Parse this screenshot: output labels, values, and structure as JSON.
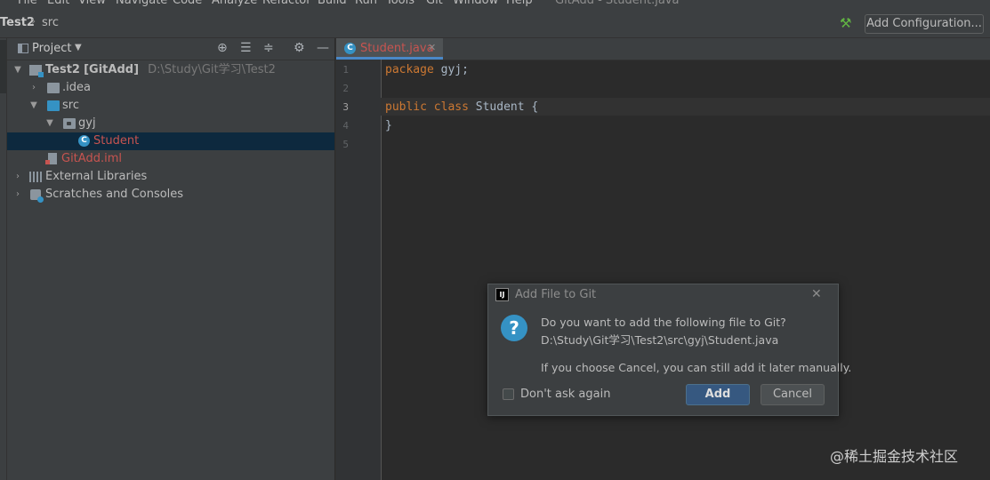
{
  "menu": [
    "File",
    "Edit",
    "View",
    "Navigate",
    "Code",
    "Analyze",
    "Refactor",
    "Build",
    "Run",
    "Tools",
    "Git",
    "Window",
    "Help",
    "GitAdd - Student.java"
  ],
  "breadcrumb": {
    "project": "Test2",
    "folder": "src"
  },
  "toolbar": {
    "run_config_label": "Add Configuration..."
  },
  "project_panel": {
    "title": "Project",
    "tree": [
      {
        "label": "Test2",
        "module": "[GitAdd]",
        "path": "D:\\Study\\Git学习\\Test2"
      },
      {
        "label": ".idea"
      },
      {
        "label": "src"
      },
      {
        "label": "gyj"
      },
      {
        "label": "Student"
      },
      {
        "label": "GitAdd.iml"
      },
      {
        "label": "External Libraries"
      },
      {
        "label": "Scratches and Consoles"
      }
    ]
  },
  "editor": {
    "tab": "Student.java",
    "line_numbers": [
      "1",
      "2",
      "3",
      "4",
      "5"
    ],
    "code": {
      "l1_kw": "package",
      "l1_rest": " gyj;",
      "l3_kw1": "public",
      "l3_kw2": "class",
      "l3_rest": " Student {",
      "l4": "}"
    }
  },
  "dialog": {
    "title": "Add File to Git",
    "question": "Do you want to add the following file to Git?",
    "path": "D:\\Study\\Git学习\\Test2\\src\\gyj\\Student.java",
    "note": "If you choose Cancel, you can still add it later manually.",
    "checkbox_label": "Don't ask again",
    "checkbox_checked": false,
    "add_button": "Add",
    "cancel_button": "Cancel"
  },
  "watermark": "@稀土掘金技术社区",
  "colors": {
    "accent": "#3592c4",
    "keyword": "#cc7832",
    "untracked": "#c75450",
    "selection": "#0d293e"
  }
}
